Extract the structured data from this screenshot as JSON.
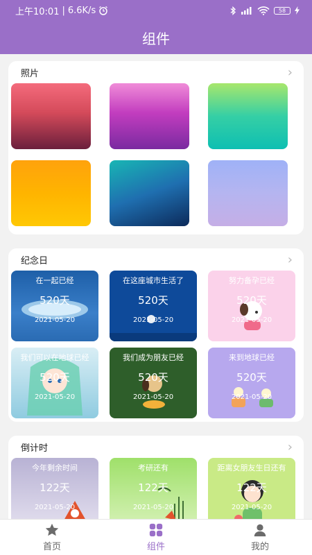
{
  "status": {
    "time": "上午10:01",
    "speed": "6.6K/s",
    "battery": "58"
  },
  "app": {
    "title": "组件"
  },
  "sections": {
    "photos": {
      "title": "照片"
    },
    "anniversary": {
      "title": "纪念日",
      "tiles": [
        {
          "title": "在一起已经",
          "days": "520天",
          "date": "2021-05-20"
        },
        {
          "title": "在这座城市生活了",
          "days": "520天",
          "date": "2021-05-20"
        },
        {
          "title": "努力备孕已经",
          "days": "520天",
          "date": "2021-05-20"
        },
        {
          "title": "我们可以在地球已经",
          "days": "520天",
          "date": "2021-05-20"
        },
        {
          "title": "我们成为朋友已经",
          "days": "520天",
          "date": "2021-05-20"
        },
        {
          "title": "来到地球已经",
          "days": "520天",
          "date": "2021-05-20"
        }
      ]
    },
    "countdown": {
      "title": "倒计时",
      "tiles": [
        {
          "title": "今年剩余时间",
          "days": "122天",
          "date": "2021-05-20"
        },
        {
          "title": "考研还有",
          "days": "122天",
          "date": "2021-05-20"
        },
        {
          "title": "距离女朋友生日还有",
          "days": "122天",
          "date": "2021-05-20"
        }
      ]
    }
  },
  "tabs": [
    {
      "label": "首页",
      "icon": "star-icon"
    },
    {
      "label": "组件",
      "icon": "grid-icon"
    },
    {
      "label": "我的",
      "icon": "person-icon"
    }
  ],
  "colors": {
    "primary": "#9a6fc8"
  }
}
